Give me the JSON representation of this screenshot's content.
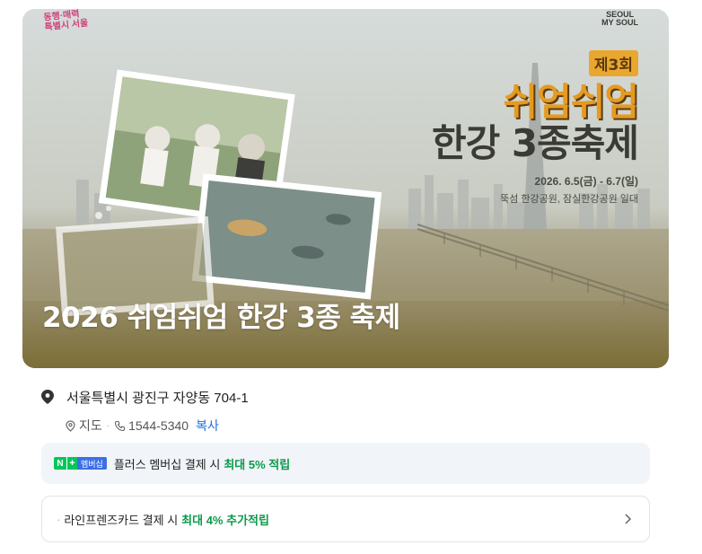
{
  "banner": {
    "title": "2026 쉬엄쉬엄 한강 3종 축제",
    "poster_edition": "제3회",
    "poster_line1": "쉬엄쉬엄",
    "poster_line2": "한강 3종축제",
    "poster_dates": "2026. 6.5(금) - 6.7(일)",
    "poster_venue": "뚝섬 한강공원, 잠실한강공원 일대",
    "logo_left_line1": "동행·매력",
    "logo_left_line2": "특별시 서울",
    "logo_right_line1": "SEOUL",
    "logo_right_line2": "MY SOUL"
  },
  "info": {
    "address": "서울특별시 광진구 자양동 704-1",
    "map_label": "지도",
    "phone": "1544-5340",
    "copy_label": "복사"
  },
  "membership": {
    "badge_n": "N",
    "badge_plus": "+",
    "badge_label": "멤버십",
    "text": "플러스 멤버십 결제 시",
    "highlight": "최대 5% 적립"
  },
  "card_offer": {
    "bullet": "·",
    "text": "라인프렌즈카드 결제 시",
    "highlight": "최대 4% 추가적립"
  },
  "icons": {
    "pin": "map-pin-icon",
    "map": "map-marker-outline-icon",
    "phone": "phone-icon",
    "chevron": "chevron-right-icon"
  },
  "colors": {
    "accent_blue": "#1f6fe0",
    "green": "#0b9a4a",
    "membership_bg": "#f1f4f8"
  }
}
